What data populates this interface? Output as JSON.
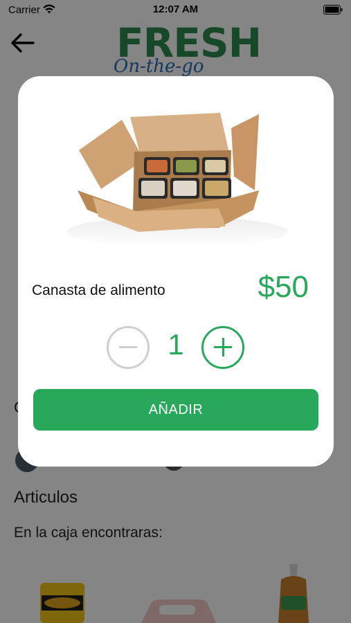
{
  "status_bar": {
    "carrier": "Carrier",
    "time": "12:07 AM"
  },
  "header": {
    "logo_title": "FRESH",
    "logo_subtitle": "On-the-go"
  },
  "page": {
    "partial_heading": "C",
    "section_title": "Articulos",
    "section_subtitle": "En la caja encontraras:"
  },
  "modal": {
    "product_name": "Canasta de alimento",
    "price": "$50",
    "quantity": "1",
    "add_label": "AÑADIR"
  },
  "colors": {
    "accent": "#27a85a",
    "logo_green": "#2d8a4e",
    "logo_blue": "#2a6db0",
    "disabled": "#cfcfcf"
  },
  "icons": [
    "wifi-icon",
    "battery-icon",
    "back-arrow-icon",
    "minus-icon",
    "plus-icon"
  ]
}
